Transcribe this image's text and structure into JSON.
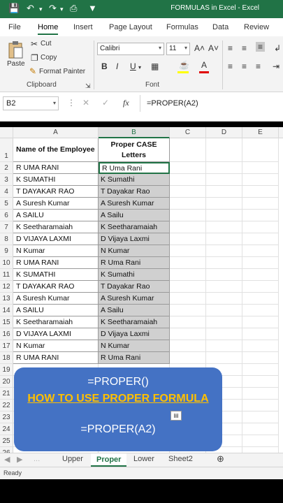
{
  "titlebar": {
    "title": "FORMULAS in Excel  -  Excel",
    "save_icon": "save-icon",
    "undo_icon": "undo-icon",
    "redo_icon": "redo-icon"
  },
  "tabs": [
    "File",
    "Home",
    "Insert",
    "Page Layout",
    "Formulas",
    "Data",
    "Review"
  ],
  "ribbon": {
    "paste": "Paste",
    "cut": "Cut",
    "copy": "Copy",
    "format_painter": "Format Painter",
    "clipboard": "Clipboard",
    "font_name": "Calibri",
    "font_size": "11",
    "bold": "B",
    "italic": "I",
    "underline": "U",
    "font": "Font"
  },
  "formula_bar": {
    "name_box": "B2",
    "fx": "fx",
    "formula": "=PROPER(A2)"
  },
  "columns": [
    "A",
    "B",
    "C",
    "D",
    "E"
  ],
  "header_row": {
    "row": "1",
    "a": "Name of the Employee",
    "b1": "Proper CASE",
    "b2": "Letters"
  },
  "rows": [
    {
      "n": "2",
      "a": "R UMA RANI",
      "b": "R Uma Rani"
    },
    {
      "n": "3",
      "a": "K SUMATHI",
      "b": "K Sumathi"
    },
    {
      "n": "4",
      "a": "T DAYAKAR RAO",
      "b": "T Dayakar Rao"
    },
    {
      "n": "5",
      "a": "A Suresh Kumar",
      "b": "A Suresh Kumar"
    },
    {
      "n": "6",
      "a": "A SAILU",
      "b": "A Sailu"
    },
    {
      "n": "7",
      "a": "K Seetharamaiah",
      "b": "K Seetharamaiah"
    },
    {
      "n": "8",
      "a": "D VIJAYA LAXMI",
      "b": "D Vijaya Laxmi"
    },
    {
      "n": "9",
      "a": "N Kumar",
      "b": "N Kumar"
    },
    {
      "n": "10",
      "a": "R UMA RANI",
      "b": "R Uma Rani"
    },
    {
      "n": "11",
      "a": "K SUMATHI",
      "b": "K Sumathi"
    },
    {
      "n": "12",
      "a": "T DAYAKAR RAO",
      "b": "T Dayakar Rao"
    },
    {
      "n": "13",
      "a": "A Suresh Kumar",
      "b": "A Suresh Kumar"
    },
    {
      "n": "14",
      "a": "A SAILU",
      "b": "A Sailu"
    },
    {
      "n": "15",
      "a": "K Seetharamaiah",
      "b": "K Seetharamaiah"
    },
    {
      "n": "16",
      "a": "D VIJAYA LAXMI",
      "b": "D Vijaya Laxmi"
    },
    {
      "n": "17",
      "a": "N Kumar",
      "b": "N Kumar"
    },
    {
      "n": "18",
      "a": "R UMA RANI",
      "b": "R Uma Rani"
    }
  ],
  "extra_rows": [
    "19",
    "20",
    "21",
    "22",
    "23",
    "24",
    "25",
    "26"
  ],
  "banner": {
    "line1": "=PROPER()",
    "line2": "HOW TO USE PROPER FORMULA",
    "line3": "=PROPER(A2)"
  },
  "sheets": [
    "Upper",
    "Proper",
    "Lower",
    "Sheet2"
  ],
  "status": "Ready",
  "colors": {
    "excel_green": "#217346",
    "banner_blue": "#4472c4",
    "banner_highlight": "#ffc000"
  }
}
